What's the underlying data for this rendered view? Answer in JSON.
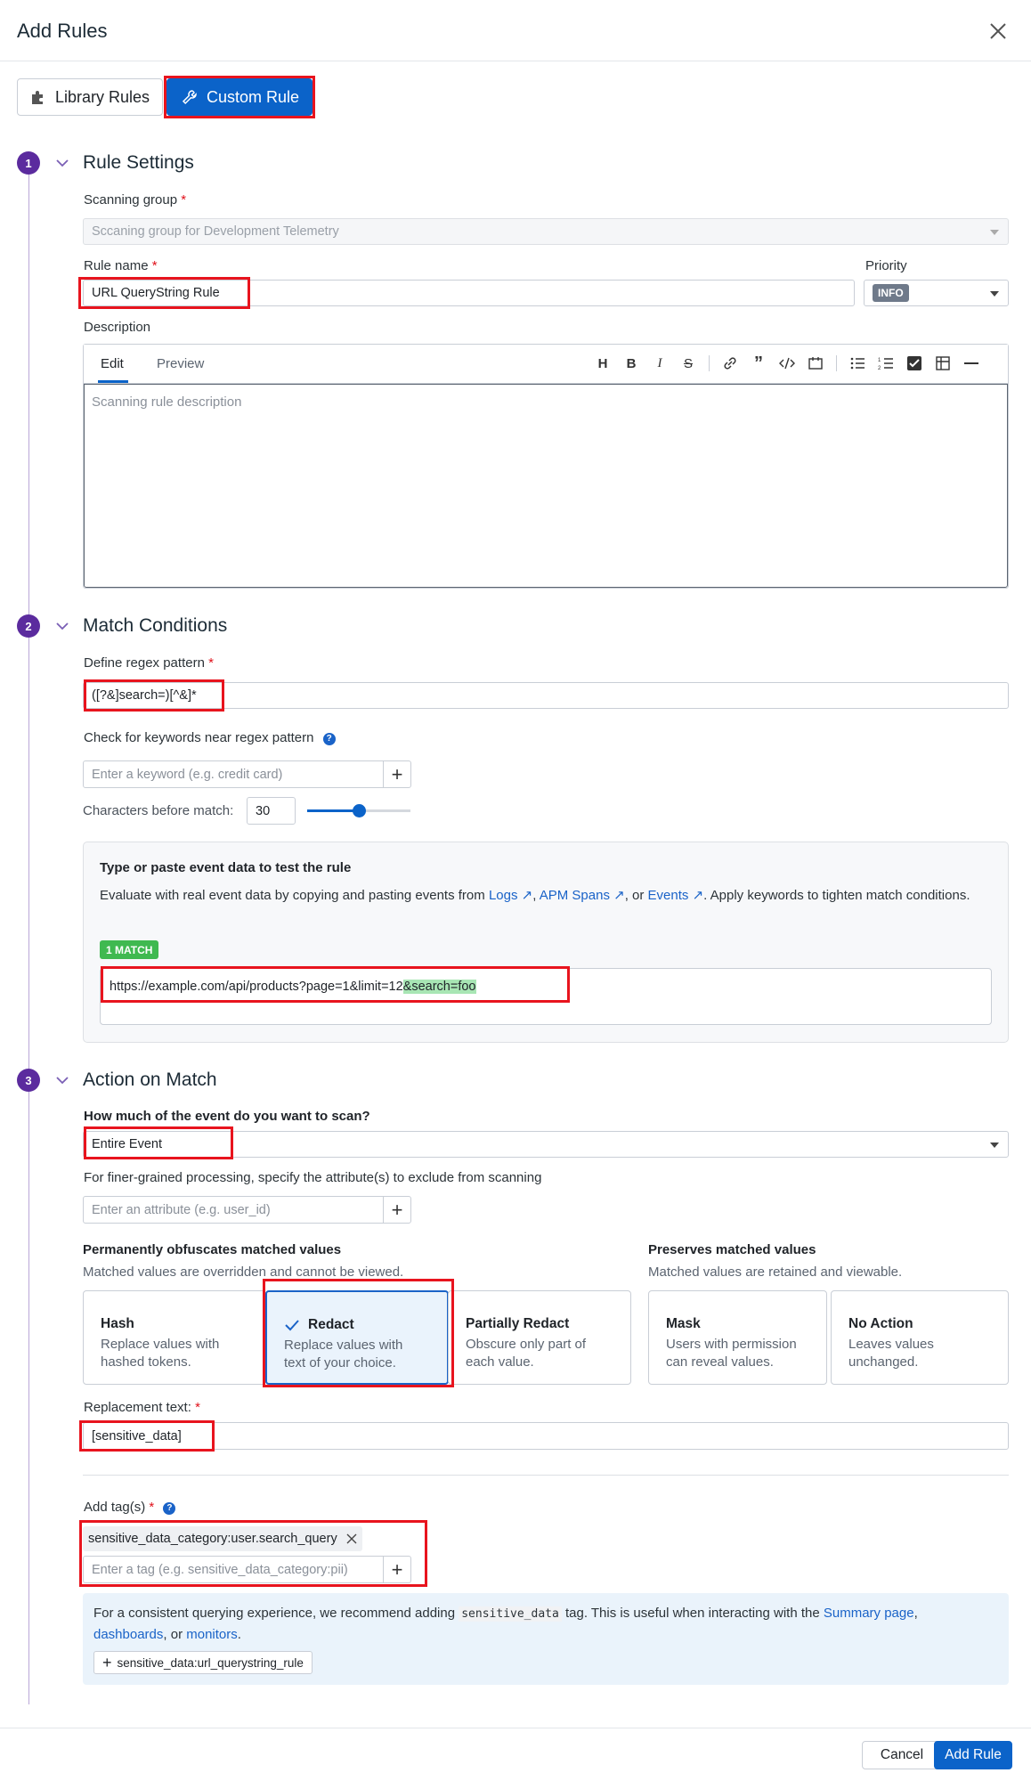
{
  "header": {
    "title": "Add Rules"
  },
  "tabs": {
    "library": "Library Rules",
    "custom": "Custom Rule"
  },
  "section1": {
    "num": "1",
    "title": "Rule Settings",
    "scanning_group_label": "Scanning group",
    "scanning_group_value": "Sccaning group for Development Telemetry",
    "rule_name_label": "Rule name",
    "rule_name_value": "URL QueryString Rule",
    "priority_label": "Priority",
    "priority_value": "INFO",
    "description_label": "Description",
    "edit_tab": "Edit",
    "preview_tab": "Preview",
    "description_placeholder": "Scanning rule description"
  },
  "section2": {
    "num": "2",
    "title": "Match Conditions",
    "regex_label": "Define regex pattern",
    "regex_value": "([?&]search=)[^&]*",
    "keywords_label": "Check for keywords near regex pattern",
    "keyword_placeholder": "Enter a keyword (e.g. credit card)",
    "chars_label": "Characters before match:",
    "chars_value": "30",
    "slider_fraction": 0.5,
    "test_title": "Type or paste event data to test the rule",
    "test_desc_1": "Evaluate with real event data by copying and pasting events from ",
    "link_logs": "Logs",
    "comma": ", ",
    "link_apm": "APM Spans",
    "or_text": ", or ",
    "link_events": "Events",
    "test_desc_2": ". Apply keywords to tighten match conditions.",
    "match_badge": "1 MATCH",
    "sample_plain": "https://example.com/api/products?page=1&limit=12",
    "sample_match": "&search=foo"
  },
  "section3": {
    "num": "3",
    "title": "Action on Match",
    "scan_question": "How much of the event do you want to scan?",
    "scan_value": "Entire Event",
    "exclude_label": "For finer-grained processing, specify the attribute(s) to exclude from scanning",
    "attribute_placeholder": "Enter an attribute (e.g. user_id)",
    "perm_title": "Permanently obfuscates matched values",
    "perm_desc": "Matched values are overridden and cannot be viewed.",
    "pres_title": "Preserves matched values",
    "pres_desc": "Matched values are retained and viewable.",
    "cards": [
      {
        "title": "Hash",
        "desc": "Replace values with hashed tokens."
      },
      {
        "title": "Redact",
        "desc": "Replace values with text of your choice."
      },
      {
        "title": "Partially Redact",
        "desc": "Obscure only part of each value."
      },
      {
        "title": "Mask",
        "desc": "Users with permission can reveal values."
      },
      {
        "title": "No Action",
        "desc": "Leaves values unchanged."
      }
    ],
    "replacement_label": "Replacement text:",
    "replacement_value": "[sensitive_data]",
    "tags_label": "Add tag(s)",
    "tag_value": "sensitive_data_category:user.search_query",
    "tag_placeholder": "Enter a tag (e.g. sensitive_data_category:pii)",
    "info_1": "For a consistent querying experience, we recommend adding ",
    "info_code": "sensitive_data",
    "info_2": " tag. This is useful when interacting with the ",
    "link_summary": "Summary page",
    "info_comma": ",",
    "link_dashboards": "dashboards",
    "info_or": ", or ",
    "link_monitors": "monitors",
    "info_end": ".",
    "suggest_tag": "sensitive_data:url_querystring_rule"
  },
  "footer": {
    "cancel": "Cancel",
    "add": "Add Rule"
  },
  "colors": {
    "accent": "#0b63c9",
    "step": "#5b2b9e",
    "highlight_red": "#e8141e",
    "match_green": "#3fb950"
  }
}
